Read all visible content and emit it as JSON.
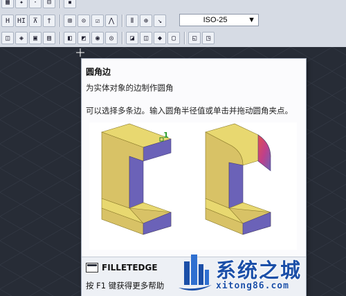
{
  "toolbar": {
    "row1": [
      "▦",
      "✦",
      "·",
      "⊟",
      "▪"
    ],
    "row2": [
      "H",
      "HI",
      "⊼",
      "†",
      "⊞",
      "⊙",
      "☑",
      "⋀",
      "Ⅱ",
      "⊕",
      "↘"
    ],
    "row3": [
      "◫",
      "◈",
      "▣",
      "▤",
      "◧",
      "◩",
      "◉",
      "◎",
      "◪",
      "◫",
      "◆",
      "▢",
      "◱",
      "◳"
    ],
    "dimstyle_value": "ISO-25",
    "dropdown_arrow": "▼"
  },
  "tooltip": {
    "title": "圆角边",
    "description": "为实体对象的边制作圆角",
    "info": "可以选择多条边。输入圆角半径值或单击并拖动圆角夹点。",
    "image_label": "1",
    "command": "FILLETEDGE",
    "help": "按 F1 键获得更多帮助"
  },
  "watermark": {
    "name": "系统之城",
    "url": "xitong86.com"
  },
  "colors": {
    "canvas": "#272c36",
    "toolbar": "#d6dbe4",
    "solid_top": "#e8d870",
    "solid_front": "#d8c266",
    "solid_side": "#6b62b8",
    "watermark": "#1b4fa8"
  }
}
